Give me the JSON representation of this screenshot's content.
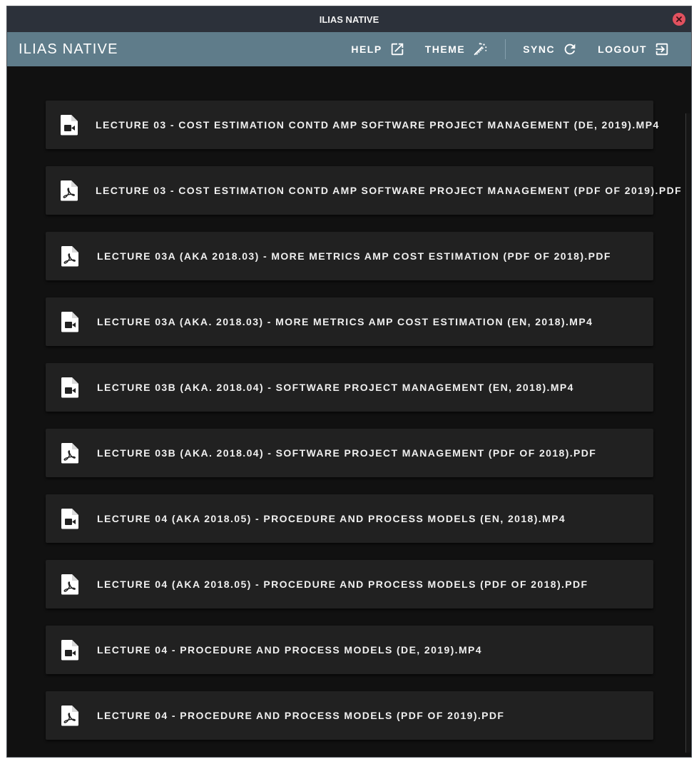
{
  "window": {
    "title": "ILIAS NATIVE",
    "close_color": "#e2515f"
  },
  "appbar": {
    "title": "ILIAS NATIVE",
    "color": "#5f7c8a",
    "buttons": [
      {
        "label": "HELP",
        "icon": "external-link-icon"
      },
      {
        "label": "THEME",
        "icon": "theme-wand-icon"
      },
      {
        "label": "SYNC",
        "icon": "sync-icon"
      },
      {
        "label": "LOGOUT",
        "icon": "logout-icon"
      }
    ]
  },
  "files": [
    {
      "label": "LECTURE 03 - COST ESTIMATION CONTD AMP SOFTWARE PROJECT MANAGEMENT (DE, 2019).MP4",
      "icon": "video-file-icon"
    },
    {
      "label": "LECTURE 03 - COST ESTIMATION CONTD AMP SOFTWARE PROJECT MANAGEMENT (PDF OF 2019).PDF",
      "icon": "pdf-file-icon"
    },
    {
      "label": "LECTURE 03A (AKA 2018.03) - MORE METRICS AMP COST ESTIMATION (PDF OF 2018).PDF",
      "icon": "pdf-file-icon"
    },
    {
      "label": "LECTURE 03A (AKA. 2018.03) - MORE METRICS AMP COST ESTIMATION (EN, 2018).MP4",
      "icon": "video-file-icon"
    },
    {
      "label": "LECTURE 03B (AKA. 2018.04) - SOFTWARE PROJECT MANAGEMENT (EN, 2018).MP4",
      "icon": "video-file-icon"
    },
    {
      "label": "LECTURE 03B (AKA. 2018.04) - SOFTWARE PROJECT MANAGEMENT (PDF OF 2018).PDF",
      "icon": "pdf-file-icon"
    },
    {
      "label": "LECTURE 04 (AKA 2018.05) - PROCEDURE AND PROCESS MODELS (EN, 2018).MP4",
      "icon": "video-file-icon"
    },
    {
      "label": "LECTURE 04 (AKA 2018.05) - PROCEDURE AND PROCESS MODELS (PDF OF 2018).PDF",
      "icon": "pdf-file-icon"
    },
    {
      "label": "LECTURE 04 - PROCEDURE AND PROCESS MODELS (DE, 2019).MP4",
      "icon": "video-file-icon"
    },
    {
      "label": "LECTURE 04 - PROCEDURE AND PROCESS MODELS (PDF OF 2019).PDF",
      "icon": "pdf-file-icon"
    }
  ]
}
